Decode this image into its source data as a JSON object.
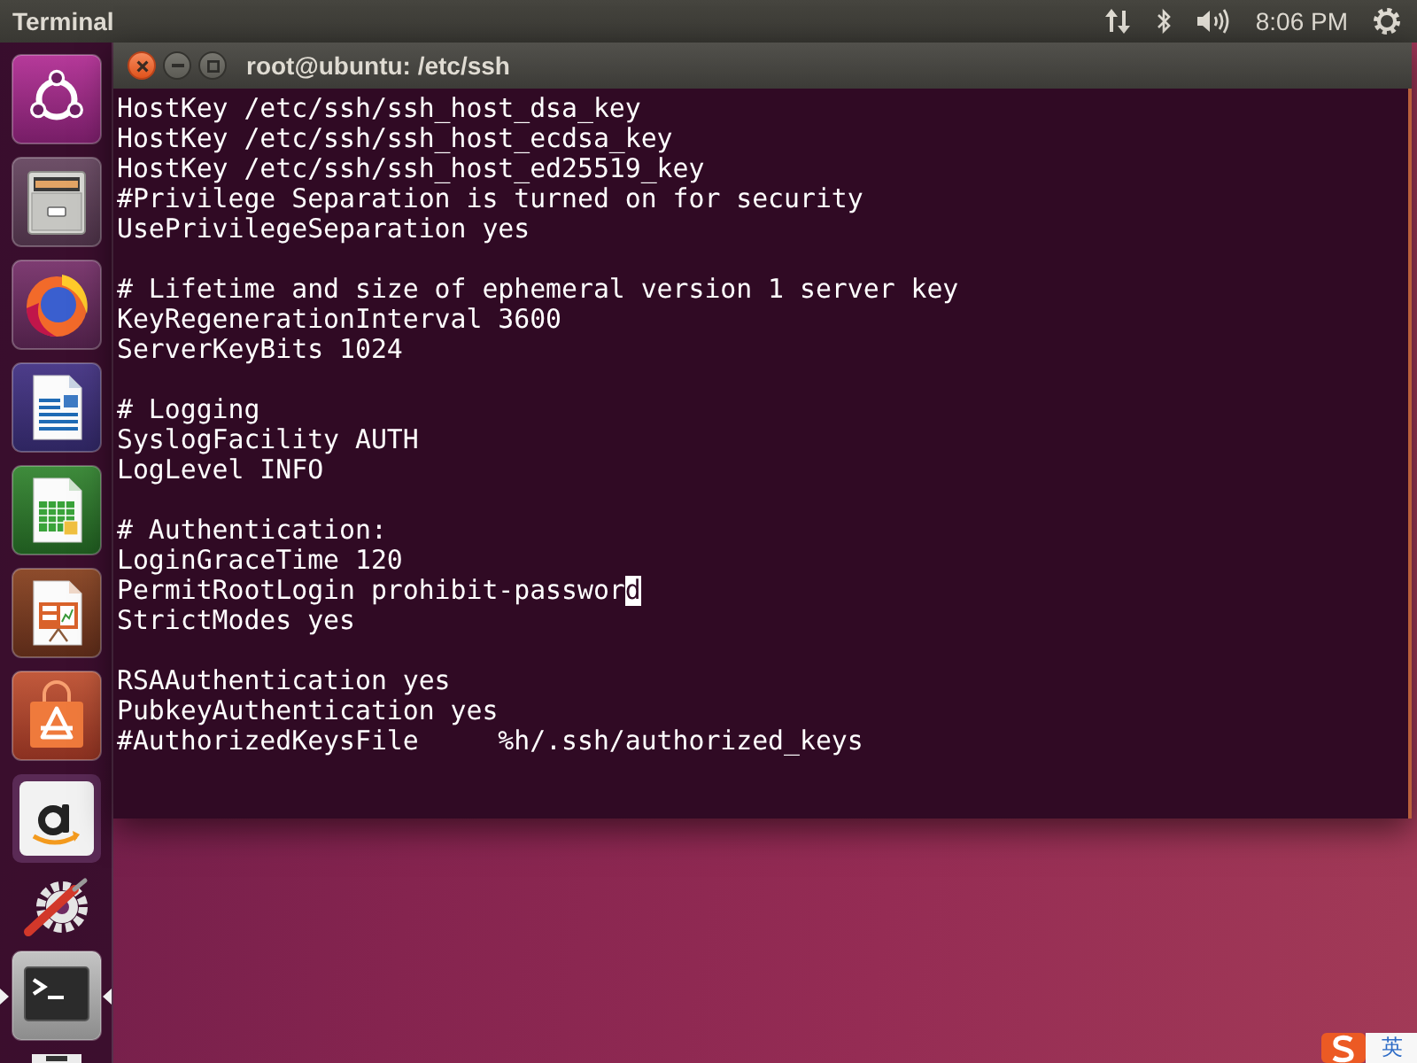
{
  "top_panel": {
    "app_title": "Terminal",
    "clock": "8:06 PM"
  },
  "launcher": {
    "items": [
      {
        "kind": "dash",
        "focused": false
      },
      {
        "kind": "files",
        "focused": false
      },
      {
        "kind": "browser",
        "focused": false
      },
      {
        "kind": "writer",
        "focused": false
      },
      {
        "kind": "calc",
        "focused": false
      },
      {
        "kind": "impress",
        "focused": false
      },
      {
        "kind": "software",
        "focused": false
      },
      {
        "kind": "amazon",
        "focused": false
      },
      {
        "kind": "settings",
        "focused": false
      },
      {
        "kind": "terminal",
        "focused": true
      },
      {
        "kind": "drive",
        "focused": false
      }
    ]
  },
  "window": {
    "title": "root@ubuntu: /etc/ssh"
  },
  "terminal": {
    "blocks": [
      {
        "lines": [
          {
            "text": "HostKey /etc/ssh/ssh_host_dsa_key",
            "cursor": false
          },
          {
            "text": "HostKey /etc/ssh/ssh_host_ecdsa_key",
            "cursor": false
          },
          {
            "text": "HostKey /etc/ssh/ssh_host_ed25519_key",
            "cursor": false
          },
          {
            "text": "#Privilege Separation is turned on for security",
            "cursor": false
          },
          {
            "text": "UsePrivilegeSeparation yes",
            "cursor": false
          }
        ]
      },
      {
        "lines": [
          {
            "text": "# Lifetime and size of ephemeral version 1 server key",
            "cursor": false
          },
          {
            "text": "KeyRegenerationInterval 3600",
            "cursor": false
          },
          {
            "text": "ServerKeyBits 1024",
            "cursor": false
          }
        ]
      },
      {
        "lines": [
          {
            "text": "# Logging",
            "cursor": false
          },
          {
            "text": "SyslogFacility AUTH",
            "cursor": false
          },
          {
            "text": "LogLevel INFO",
            "cursor": false
          }
        ]
      },
      {
        "lines": [
          {
            "text": "# Authentication:",
            "cursor": false
          },
          {
            "text": "LoginGraceTime 120",
            "cursor": false
          },
          {
            "text": "PermitRootLogin prohibit-password",
            "cursor": true
          },
          {
            "text": "StrictModes yes",
            "cursor": false
          }
        ]
      },
      {
        "lines": [
          {
            "text": "RSAAuthentication yes",
            "cursor": false
          },
          {
            "text": "PubkeyAuthentication yes",
            "cursor": false
          },
          {
            "text": "#AuthorizedKeysFile     %h/.ssh/authorized_keys",
            "cursor": false
          }
        ]
      }
    ]
  },
  "input_method": {
    "mode": "英"
  }
}
